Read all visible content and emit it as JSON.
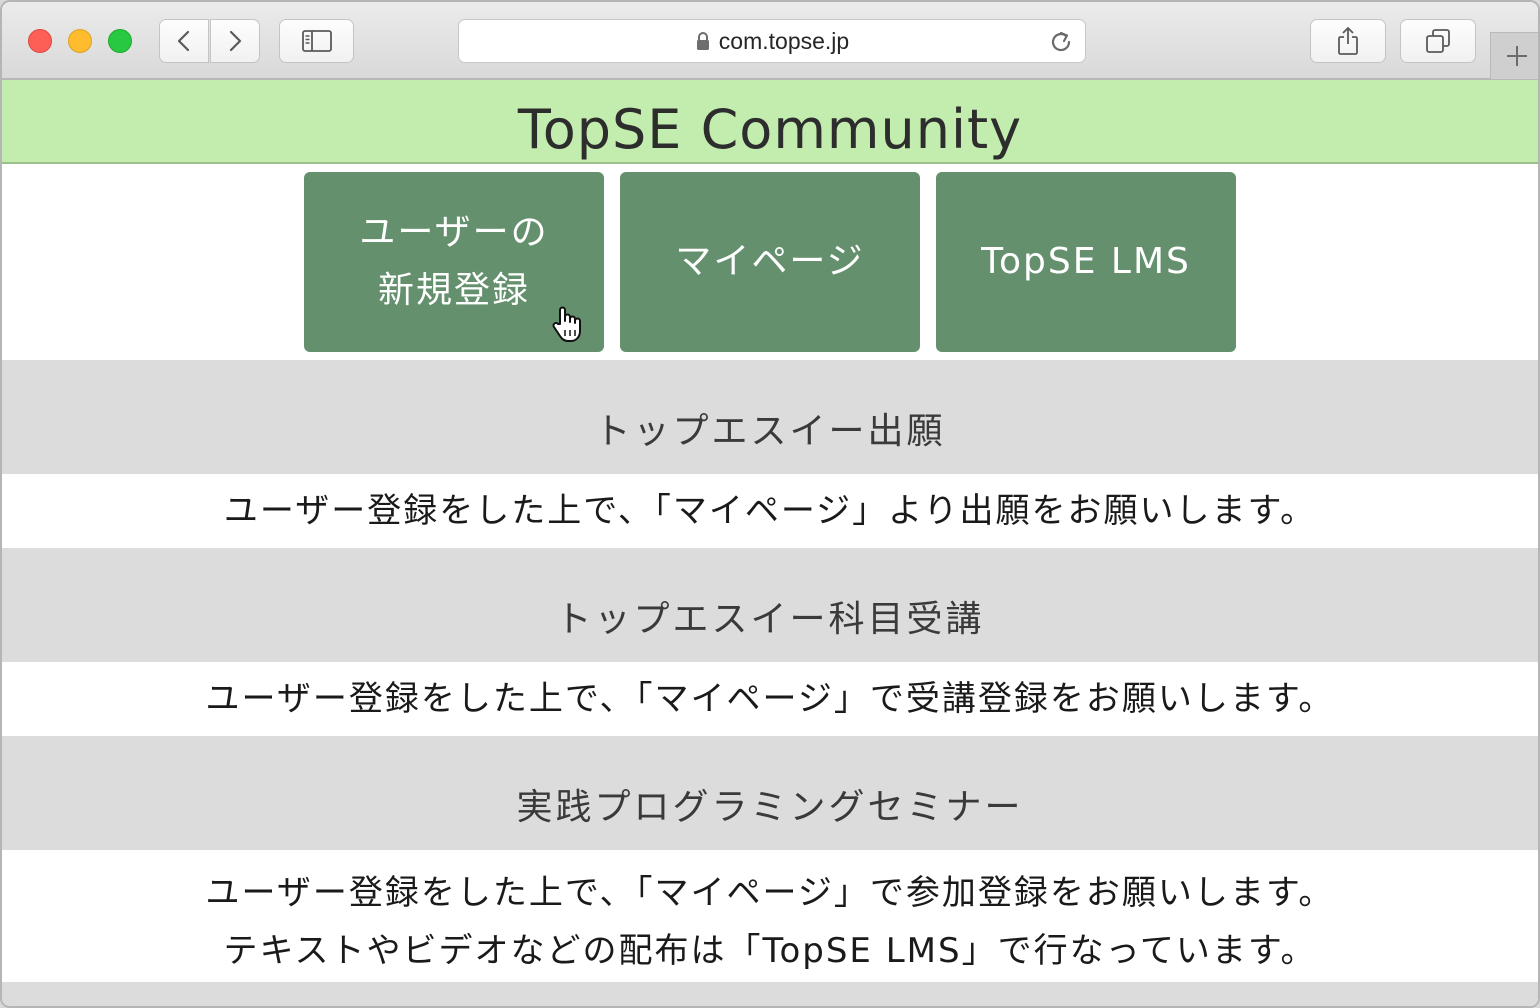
{
  "browser": {
    "url": "com.topse.jp"
  },
  "site": {
    "title": "TopSE Community"
  },
  "nav": {
    "register_line1": "ユーザーの",
    "register_line2": "新規登録",
    "mypage": "マイページ",
    "lms": "TopSE LMS"
  },
  "sections": [
    {
      "heading": "トップエスイー出願",
      "body": "ユーザー登録をした上で、「マイページ」より出願をお願いします。"
    },
    {
      "heading": "トップエスイー科目受講",
      "body": "ユーザー登録をした上で、「マイページ」で受講登録をお願いします。"
    },
    {
      "heading": "実践プログラミングセミナー",
      "body_line1": "ユーザー登録をした上で、「マイページ」で参加登録をお願いします。",
      "body_line2": "テキストやビデオなどの配布は「TopSE LMS」で行なっています。"
    }
  ],
  "colors": {
    "header_bg": "#c3edae",
    "nav_button": "#64906e",
    "section_bg": "#dcdcdc"
  }
}
